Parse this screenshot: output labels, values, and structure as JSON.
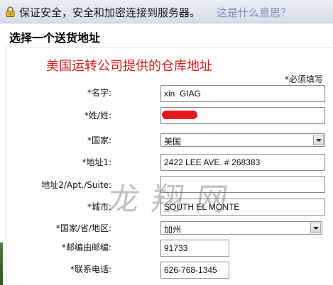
{
  "security_bar": {
    "text": "保证安全，安全和加密连接到服务器。",
    "help_link": "这是什么意思？",
    "icon": "lock-icon"
  },
  "panel": {
    "title": "选择一个送货地址"
  },
  "form": {
    "heading": "美国运转公司提供的仓库地址",
    "required_note": "*必须填写",
    "fields": {
      "name": {
        "label": "*名字:",
        "value": "xin  GIAG"
      },
      "surname": {
        "label": "*姓/姓:",
        "value": ""
      },
      "country": {
        "label": "*国家:",
        "value": "美国"
      },
      "address1": {
        "label": "*地址1:",
        "value": "2422 LEE AVE. # 268383"
      },
      "address2": {
        "label": "地址2/Apt./Suite:",
        "value": ""
      },
      "city": {
        "label": "*城市:",
        "value": "SOUTH EL MONTE"
      },
      "state": {
        "label": "*国家/省/地区:",
        "value": "加州"
      },
      "zip": {
        "label": "*邮编由邮编:",
        "value": "91733"
      },
      "phone": {
        "label": "*联系电话:",
        "value": "626-768-1345"
      }
    }
  },
  "watermark": "龙翔网",
  "colors": {
    "heading_red": "#d4211a",
    "help_link_blue": "#7d8fbf",
    "redaction_red": "#e8161b"
  }
}
